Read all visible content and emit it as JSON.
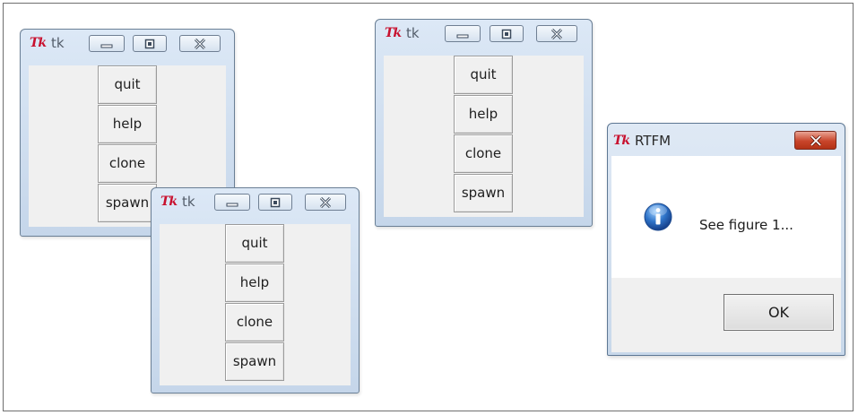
{
  "tk_windows": [
    {
      "title": "tk",
      "logo": "Tk",
      "buttons": [
        "quit",
        "help",
        "clone",
        "spawn"
      ]
    },
    {
      "title": "tk",
      "logo": "Tk",
      "buttons": [
        "quit",
        "help",
        "clone",
        "spawn"
      ]
    },
    {
      "title": "tk",
      "logo": "Tk",
      "buttons": [
        "quit",
        "help",
        "clone",
        "spawn"
      ]
    }
  ],
  "dialog": {
    "title": "RTFM",
    "logo": "Tk",
    "message": "See figure 1...",
    "ok_label": "OK",
    "icon": "info-icon"
  }
}
